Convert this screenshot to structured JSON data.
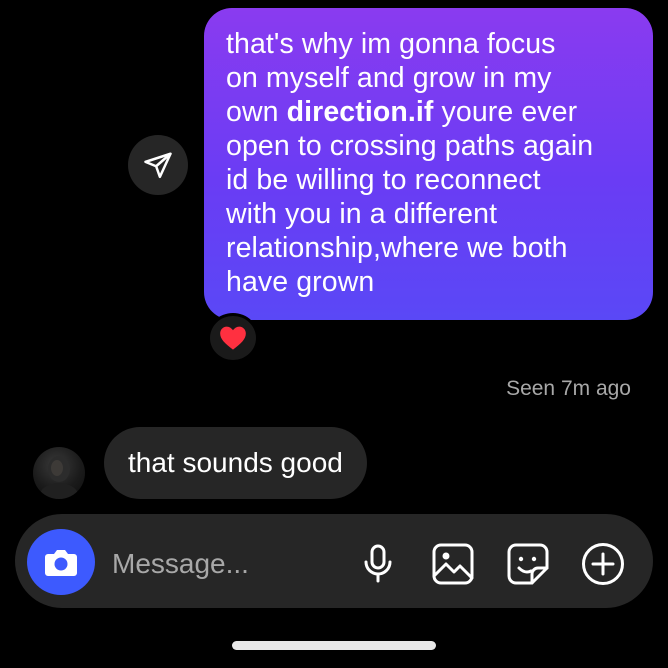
{
  "thread": {
    "sent_message": {
      "lines": [
        "that's why im gonna focus",
        "on myself and grow in my",
        "direction.if",
        "youre ever",
        "open to crossing paths again",
        "id be willing to reconnect",
        "with you in a different",
        "relationship,where we both",
        "have grown"
      ],
      "line3_prefix": "own ",
      "reaction": "❤️"
    },
    "seen_status": "Seen 7m ago",
    "received_message": "that sounds good"
  },
  "composer": {
    "placeholder": "Message..."
  },
  "icons": {
    "share": "send-icon",
    "camera": "camera-icon",
    "mic": "microphone-icon",
    "gallery": "gallery-icon",
    "sticker": "sticker-icon",
    "more": "plus-circle-icon"
  },
  "colors": {
    "background": "#000000",
    "sent_bubble_top": "#8a3bf0",
    "sent_bubble_bottom": "#5a48f6",
    "received_bubble": "#262626",
    "camera_button": "#3d5afe",
    "seen_text": "#a8a8a8"
  }
}
